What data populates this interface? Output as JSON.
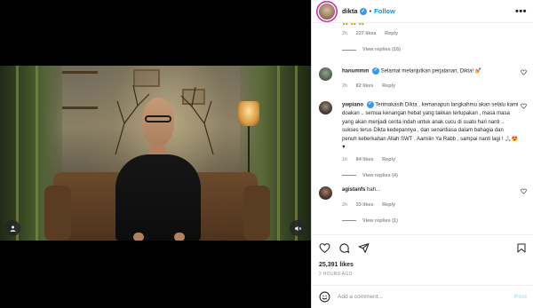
{
  "header": {
    "username": "dikta",
    "separator": "•",
    "follow_label": "Follow",
    "more_label": "•••"
  },
  "comments": [
    {
      "id": "top-partial",
      "username": "",
      "text": "",
      "time": "2h",
      "likes": "227 likes",
      "reply_label": "Reply",
      "view_replies": "View replies (16)"
    },
    {
      "id": "hanummm",
      "username": "hanummm",
      "verified": true,
      "text": "Selamat melanjutkan perjalanan, Dikta! 💅",
      "time": "2h",
      "likes": "82 likes",
      "reply_label": "Reply",
      "view_replies": ""
    },
    {
      "id": "ywpiano",
      "username": "ywpiano",
      "verified": true,
      "text": "Terimakasih Dikta , kemanapun langkahmu akan selalu kami doakan .. semua kenangan hebat yang takkan terlupakan , masa masa yang akan menjadi cerita indah untuk anak cucu di suatu hari nanti .. sukses terus Dikta kedepannya , dan senantiasa dalam bahagia dan penuh keberkahan Allah SWT . Aamiiin Ya Rabb , sampai nanti lagi ! 🙏🏻😍♥",
      "time": "1h",
      "likes": "84 likes",
      "reply_label": "Reply",
      "view_replies": "View replies (4)"
    },
    {
      "id": "agistanfs",
      "username": "agistanfs",
      "verified": false,
      "text": "hah...",
      "time": "2h",
      "likes": "33 likes",
      "reply_label": "Reply",
      "view_replies": "View replies (1)"
    }
  ],
  "actions": {
    "likes_count": "25,391 likes",
    "time_ago": "2 HOURS AGO"
  },
  "add_comment": {
    "placeholder": "Add a comment...",
    "post_label": "Post"
  },
  "colors": {
    "accent": "#0095f6",
    "verified": "#3897f0",
    "muted": "#8e8e8e",
    "text": "#262626",
    "post_disabled": "#b2dffc"
  },
  "icons": {
    "like": "heart-icon",
    "comment": "comment-icon",
    "share": "share-icon",
    "save": "bookmark-icon",
    "more": "more-options-icon",
    "user_tag": "user-tag-icon",
    "mute": "mute-icon",
    "emoji": "emoji-icon"
  }
}
